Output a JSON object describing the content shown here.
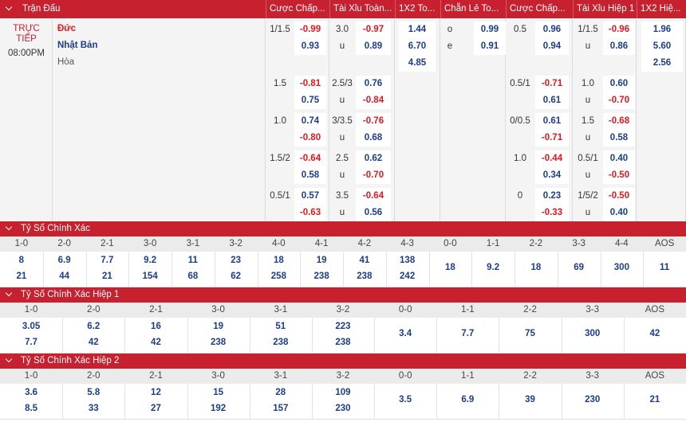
{
  "header": [
    "Trận Đấu",
    "Cược Chấp...",
    "Tài Xỉu Toàn...",
    "1X2 To...",
    "Chẵn Lẻ To...",
    "Cược Chấp...",
    "Tài Xỉu Hiệp 1",
    "1X2 Hiệ..."
  ],
  "match": {
    "status_line1": "TRỰC",
    "status_line2": "TIẾP",
    "time": "08:00PM",
    "home": "Đức",
    "away": "Nhật Bản",
    "draw": "Hòa",
    "colors": {
      "accent": "#c7202f",
      "negative": "#e0181f",
      "positive": "#1c3d8c"
    },
    "rows": [
      {
        "hcap": "1/1.5",
        "hcap_home": "-0.99",
        "hcap_away": "0.93",
        "ou": "3.0",
        "ou_over": "-0.97",
        "ou_under_label": "u",
        "ou_under": "0.89",
        "x12": [
          "1.44",
          "6.70",
          "4.85"
        ],
        "oe": [
          "o",
          "0.99",
          "e",
          "0.91"
        ],
        "h1_hcap": "0.5",
        "h1_hcap_home": "0.96",
        "h1_hcap_away": "0.94",
        "h1_ou": "1/1.5",
        "h1_ou_over": "-0.96",
        "h1_ou_under_label": "u",
        "h1_ou_under": "0.86",
        "h1_x12": [
          "1.96",
          "5.60",
          "2.56"
        ]
      },
      {
        "hcap": "1.5",
        "hcap_home": "-0.81",
        "hcap_away": "0.75",
        "ou": "2.5/3",
        "ou_over": "0.76",
        "ou_under_label": "u",
        "ou_under": "-0.84",
        "h1_hcap": "0.5/1",
        "h1_hcap_home": "-0.71",
        "h1_hcap_away": "0.61",
        "h1_ou": "1.0",
        "h1_ou_over": "0.60",
        "h1_ou_under_label": "u",
        "h1_ou_under": "-0.70"
      },
      {
        "hcap": "1.0",
        "hcap_home": "0.74",
        "hcap_away": "-0.80",
        "ou": "3/3.5",
        "ou_over": "-0.76",
        "ou_under_label": "u",
        "ou_under": "0.68",
        "h1_hcap": "0/0.5",
        "h1_hcap_home": "0.61",
        "h1_hcap_away": "-0.71",
        "h1_ou": "1.5",
        "h1_ou_over": "-0.68",
        "h1_ou_under_label": "u",
        "h1_ou_under": "0.58"
      },
      {
        "hcap": "1.5/2",
        "hcap_home": "-0.64",
        "hcap_away": "0.58",
        "ou": "2.5",
        "ou_over": "0.62",
        "ou_under_label": "u",
        "ou_under": "-0.70",
        "h1_hcap": "1.0",
        "h1_hcap_home": "-0.44",
        "h1_hcap_away": "0.34",
        "h1_ou": "0.5/1",
        "h1_ou_over": "0.40",
        "h1_ou_under_label": "u",
        "h1_ou_under": "-0.50"
      },
      {
        "hcap": "0.5/1",
        "hcap_home": "0.57",
        "hcap_away": "-0.63",
        "ou": "3.5",
        "ou_over": "-0.64",
        "ou_under_label": "u",
        "ou_under": "0.56",
        "h1_hcap": "0",
        "h1_hcap_home": "0.23",
        "h1_hcap_away": "-0.33",
        "h1_ou": "1/5/2",
        "h1_ou_over": "-0.50",
        "h1_ou_under_label": "u",
        "h1_ou_under": "0.40"
      }
    ]
  },
  "sections": [
    {
      "title": "Tỷ Số Chính Xác",
      "scores": [
        "1-0",
        "2-0",
        "2-1",
        "3-0",
        "3-1",
        "3-2",
        "4-0",
        "4-1",
        "4-2",
        "4-3",
        "0-0",
        "1-1",
        "2-2",
        "3-3",
        "4-4",
        "AOS"
      ],
      "home": [
        "8",
        "6.9",
        "7.7",
        "9.2",
        "11",
        "23",
        "18",
        "19",
        "41",
        "138"
      ],
      "away": [
        "21",
        "44",
        "21",
        "154",
        "68",
        "62",
        "258",
        "238",
        "238",
        "242"
      ],
      "single": [
        "18",
        "9.2",
        "18",
        "69",
        "300",
        "11"
      ]
    },
    {
      "title": "Tỷ Số Chính Xác Hiệp 1",
      "scores": [
        "1-0",
        "2-0",
        "2-1",
        "3-0",
        "3-1",
        "3-2",
        "0-0",
        "1-1",
        "2-2",
        "3-3",
        "AOS"
      ],
      "home": [
        "3.05",
        "6.2",
        "16",
        "19",
        "51",
        "223"
      ],
      "away": [
        "7.7",
        "42",
        "42",
        "238",
        "238",
        "238"
      ],
      "single": [
        "3.4",
        "7.7",
        "75",
        "300",
        "42"
      ]
    },
    {
      "title": "Tỷ Số Chính Xác Hiệp 2",
      "scores": [
        "1-0",
        "2-0",
        "2-1",
        "3-0",
        "3-1",
        "3-2",
        "0-0",
        "1-1",
        "2-2",
        "3-3",
        "AOS"
      ],
      "home": [
        "3.6",
        "5.8",
        "12",
        "15",
        "28",
        "109"
      ],
      "away": [
        "8.5",
        "33",
        "27",
        "192",
        "157",
        "230"
      ],
      "single": [
        "3.5",
        "6.9",
        "39",
        "230",
        "21"
      ]
    }
  ]
}
